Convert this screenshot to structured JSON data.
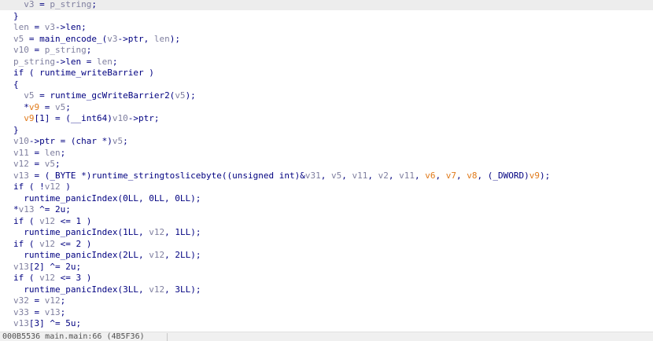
{
  "code_lines": [
    {
      "indent": "  ",
      "highlight": true,
      "tokens": [
        [
          "var",
          "v3"
        ],
        [
          "plain",
          " = "
        ],
        [
          "var",
          "p_string"
        ],
        [
          "plain",
          ";"
        ]
      ]
    },
    {
      "indent": "",
      "tokens": [
        [
          "plain",
          "}"
        ]
      ]
    },
    {
      "indent": "",
      "tokens": [
        [
          "var",
          "len"
        ],
        [
          "plain",
          " = "
        ],
        [
          "var",
          "v3"
        ],
        [
          "plain",
          "->len;"
        ]
      ]
    },
    {
      "indent": "",
      "tokens": [
        [
          "var",
          "v5"
        ],
        [
          "plain",
          " = main_encode_("
        ],
        [
          "var",
          "v3"
        ],
        [
          "plain",
          "->ptr, "
        ],
        [
          "var",
          "len"
        ],
        [
          "plain",
          ");"
        ]
      ]
    },
    {
      "indent": "",
      "tokens": [
        [
          "var",
          "v10"
        ],
        [
          "plain",
          " = "
        ],
        [
          "var",
          "p_string"
        ],
        [
          "plain",
          ";"
        ]
      ]
    },
    {
      "indent": "",
      "tokens": [
        [
          "var",
          "p_string"
        ],
        [
          "plain",
          "->len = "
        ],
        [
          "var",
          "len"
        ],
        [
          "plain",
          ";"
        ]
      ]
    },
    {
      "indent": "",
      "tokens": [
        [
          "kw",
          "if"
        ],
        [
          "plain",
          " ( runtime_writeBarrier )"
        ]
      ]
    },
    {
      "indent": "",
      "tokens": [
        [
          "plain",
          "{"
        ]
      ]
    },
    {
      "indent": "  ",
      "tokens": [
        [
          "var",
          "v5"
        ],
        [
          "plain",
          " = runtime_gcWriteBarrier2("
        ],
        [
          "var",
          "v5"
        ],
        [
          "plain",
          ");"
        ]
      ]
    },
    {
      "indent": "  ",
      "tokens": [
        [
          "plain",
          "*"
        ],
        [
          "arg",
          "v9"
        ],
        [
          "plain",
          " = "
        ],
        [
          "var",
          "v5"
        ],
        [
          "plain",
          ";"
        ]
      ]
    },
    {
      "indent": "  ",
      "tokens": [
        [
          "arg",
          "v9"
        ],
        [
          "plain",
          "[1] = (__int64)"
        ],
        [
          "var",
          "v10"
        ],
        [
          "plain",
          "->ptr;"
        ]
      ]
    },
    {
      "indent": "",
      "tokens": [
        [
          "plain",
          "}"
        ]
      ]
    },
    {
      "indent": "",
      "tokens": [
        [
          "var",
          "v10"
        ],
        [
          "plain",
          "->ptr = (char *)"
        ],
        [
          "var",
          "v5"
        ],
        [
          "plain",
          ";"
        ]
      ]
    },
    {
      "indent": "",
      "tokens": [
        [
          "var",
          "v11"
        ],
        [
          "plain",
          " = "
        ],
        [
          "var",
          "len"
        ],
        [
          "plain",
          ";"
        ]
      ]
    },
    {
      "indent": "",
      "tokens": [
        [
          "var",
          "v12"
        ],
        [
          "plain",
          " = "
        ],
        [
          "var",
          "v5"
        ],
        [
          "plain",
          ";"
        ]
      ]
    },
    {
      "indent": "",
      "tokens": [
        [
          "var",
          "v13"
        ],
        [
          "plain",
          " = (_BYTE *)runtime_stringtoslicebyte((unsigned int)&"
        ],
        [
          "var",
          "v31"
        ],
        [
          "plain",
          ", "
        ],
        [
          "var",
          "v5"
        ],
        [
          "plain",
          ", "
        ],
        [
          "var",
          "v11"
        ],
        [
          "plain",
          ", "
        ],
        [
          "var",
          "v2"
        ],
        [
          "plain",
          ", "
        ],
        [
          "var",
          "v11"
        ],
        [
          "plain",
          ", "
        ],
        [
          "arg",
          "v6"
        ],
        [
          "plain",
          ", "
        ],
        [
          "arg",
          "v7"
        ],
        [
          "plain",
          ", "
        ],
        [
          "arg",
          "v8"
        ],
        [
          "plain",
          ", (_DWORD)"
        ],
        [
          "arg",
          "v9"
        ],
        [
          "plain",
          ");"
        ]
      ]
    },
    {
      "indent": "",
      "tokens": [
        [
          "kw",
          "if"
        ],
        [
          "plain",
          " ( !"
        ],
        [
          "var",
          "v12"
        ],
        [
          "plain",
          " )"
        ]
      ]
    },
    {
      "indent": "  ",
      "tokens": [
        [
          "plain",
          "runtime_panicIndex(0LL, 0LL, 0LL);"
        ]
      ]
    },
    {
      "indent": "",
      "tokens": [
        [
          "plain",
          "*"
        ],
        [
          "var",
          "v13"
        ],
        [
          "plain",
          " ^= 2u;"
        ]
      ]
    },
    {
      "indent": "",
      "tokens": [
        [
          "kw",
          "if"
        ],
        [
          "plain",
          " ( "
        ],
        [
          "var",
          "v12"
        ],
        [
          "plain",
          " <= 1 )"
        ]
      ]
    },
    {
      "indent": "  ",
      "tokens": [
        [
          "plain",
          "runtime_panicIndex(1LL, "
        ],
        [
          "var",
          "v12"
        ],
        [
          "plain",
          ", 1LL);"
        ]
      ]
    },
    {
      "indent": "",
      "tokens": [
        [
          "kw",
          "if"
        ],
        [
          "plain",
          " ( "
        ],
        [
          "var",
          "v12"
        ],
        [
          "plain",
          " <= 2 )"
        ]
      ]
    },
    {
      "indent": "  ",
      "tokens": [
        [
          "plain",
          "runtime_panicIndex(2LL, "
        ],
        [
          "var",
          "v12"
        ],
        [
          "plain",
          ", 2LL);"
        ]
      ]
    },
    {
      "indent": "",
      "tokens": [
        [
          "var",
          "v13"
        ],
        [
          "plain",
          "[2] ^= 2u;"
        ]
      ]
    },
    {
      "indent": "",
      "tokens": [
        [
          "kw",
          "if"
        ],
        [
          "plain",
          " ( "
        ],
        [
          "var",
          "v12"
        ],
        [
          "plain",
          " <= 3 )"
        ]
      ]
    },
    {
      "indent": "  ",
      "tokens": [
        [
          "plain",
          "runtime_panicIndex(3LL, "
        ],
        [
          "var",
          "v12"
        ],
        [
          "plain",
          ", 3LL);"
        ]
      ]
    },
    {
      "indent": "",
      "tokens": [
        [
          "var",
          "v32"
        ],
        [
          "plain",
          " = "
        ],
        [
          "var",
          "v12"
        ],
        [
          "plain",
          ";"
        ]
      ]
    },
    {
      "indent": "",
      "tokens": [
        [
          "var",
          "v33"
        ],
        [
          "plain",
          " = "
        ],
        [
          "var",
          "v13"
        ],
        [
          "plain",
          ";"
        ]
      ]
    },
    {
      "indent": "",
      "tokens": [
        [
          "var",
          "v13"
        ],
        [
          "plain",
          "[3] ^= 5u;"
        ]
      ]
    }
  ],
  "status_bar": {
    "text": "000B5536 main.main:66 (4B5F36)"
  },
  "colors": {
    "plain": "#000080",
    "variable": "#7f7f9f",
    "argument": "#e07a1a",
    "highlight_line": "#ededed",
    "status_bg": "#f0f0f0"
  }
}
